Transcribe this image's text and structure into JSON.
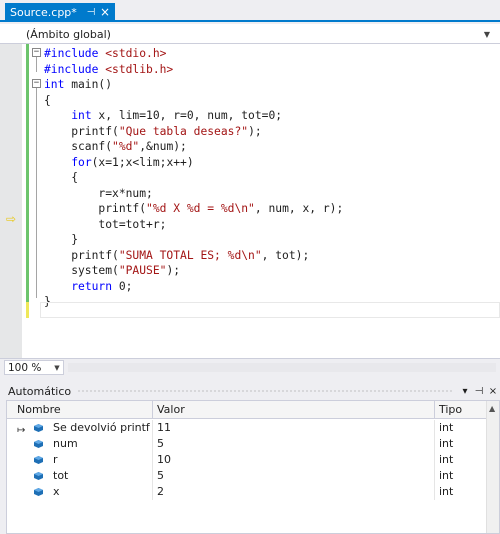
{
  "tab": {
    "title": "Source.cpp*",
    "pin": "⊣",
    "close": "×"
  },
  "scope": {
    "value": "(Ámbito global)"
  },
  "code": [
    [
      {
        "t": "#include ",
        "c": "pp"
      },
      {
        "t": "<stdio.h>",
        "c": "str"
      }
    ],
    [
      {
        "t": "#include ",
        "c": "pp"
      },
      {
        "t": "<stdlib.h>",
        "c": "str"
      }
    ],
    [
      {
        "t": "int",
        "c": "kw"
      },
      {
        "t": " main()",
        "c": ""
      }
    ],
    [
      {
        "t": "{",
        "c": ""
      }
    ],
    [
      {
        "t": "    ",
        "c": ""
      },
      {
        "t": "int",
        "c": "kw"
      },
      {
        "t": " x, lim=10, r=0, num, tot=0;",
        "c": ""
      }
    ],
    [
      {
        "t": "    printf(",
        "c": ""
      },
      {
        "t": "\"Que tabla deseas?\"",
        "c": "str"
      },
      {
        "t": ");",
        "c": ""
      }
    ],
    [
      {
        "t": "    scanf(",
        "c": ""
      },
      {
        "t": "\"%d\"",
        "c": "str"
      },
      {
        "t": ",&num);",
        "c": ""
      }
    ],
    [
      {
        "t": "    ",
        "c": ""
      },
      {
        "t": "for",
        "c": "kw"
      },
      {
        "t": "(x=1;x<lim;x++)",
        "c": ""
      }
    ],
    [
      {
        "t": "    {",
        "c": ""
      }
    ],
    [
      {
        "t": "        r=x*num;",
        "c": ""
      }
    ],
    [
      {
        "t": "        printf(",
        "c": ""
      },
      {
        "t": "\"%d X %d = %d\\n\"",
        "c": "str"
      },
      {
        "t": ", num, x, r);",
        "c": ""
      }
    ],
    [
      {
        "t": "        tot=tot+r;",
        "c": ""
      }
    ],
    [
      {
        "t": "    }",
        "c": ""
      }
    ],
    [
      {
        "t": "    printf(",
        "c": ""
      },
      {
        "t": "\"SUMA TOTAL ES; %d\\n\"",
        "c": "str"
      },
      {
        "t": ", tot);",
        "c": ""
      }
    ],
    [
      {
        "t": "    system(",
        "c": ""
      },
      {
        "t": "\"PAUSE\"",
        "c": "str"
      },
      {
        "t": ");",
        "c": ""
      }
    ],
    [
      {
        "t": "    ",
        "c": ""
      },
      {
        "t": "return",
        "c": "kw"
      },
      {
        "t": " 0;",
        "c": ""
      }
    ],
    [
      {
        "t": "}",
        "c": ""
      }
    ]
  ],
  "zoom": {
    "value": "100 %"
  },
  "panel": {
    "title": "Automático",
    "btn_dropdown": "▾",
    "btn_pin": "⊣",
    "btn_close": "×"
  },
  "grid": {
    "columns": [
      "Nombre",
      "Valor",
      "Tipo"
    ],
    "rows": [
      {
        "name": "Se devolvió printf",
        "value": "11",
        "type": "int",
        "icon": "return-value-icon"
      },
      {
        "name": "num",
        "value": "5",
        "type": "int",
        "icon": "variable-icon"
      },
      {
        "name": "r",
        "value": "10",
        "type": "int",
        "icon": "variable-icon"
      },
      {
        "name": "tot",
        "value": "5",
        "type": "int",
        "icon": "variable-icon"
      },
      {
        "name": "x",
        "value": "2",
        "type": "int",
        "icon": "variable-icon"
      }
    ]
  },
  "colors": {
    "accent": "#007acc",
    "keyword": "#0000ff",
    "string": "#a31515",
    "changed": "#6cc46c"
  }
}
